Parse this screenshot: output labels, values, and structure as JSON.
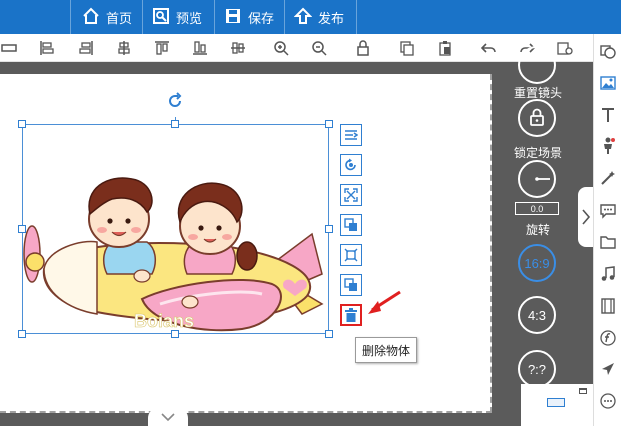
{
  "topbar": {
    "home_label": "首页",
    "preview_label": "预览",
    "save_label": "保存",
    "publish_label": "发布"
  },
  "toolbar": {
    "icons": [
      "align-left-icon",
      "align-left-edge-icon",
      "align-right-edge-icon",
      "align-center-h-icon",
      "align-top-icon",
      "align-bottom-icon",
      "align-center-v-icon",
      "zoom-in-icon",
      "zoom-out-icon",
      "lock-icon",
      "copy-icon",
      "paste-icon",
      "undo-icon",
      "redo-icon",
      "settings-icon"
    ]
  },
  "rightpanel": {
    "icons": [
      "layers-icon",
      "image-icon",
      "text-icon",
      "character-icon",
      "magic-icon",
      "speech-bubble-icon",
      "folder-icon",
      "music-icon",
      "film-icon",
      "formula-icon",
      "plane-icon",
      "more-icon"
    ]
  },
  "side": {
    "reset_camera_label": "重置镜头",
    "lock_scene_label": "锁定场景",
    "rotate_value": "0.0",
    "rotate_label": "旋转",
    "ratio_169": "16:9",
    "ratio_43": "4:3",
    "ratio_custom": "?:?"
  },
  "canvas": {
    "image_text": "Boians"
  },
  "tooltip": {
    "text": "删除物体"
  },
  "colors": {
    "topbar": "#1a73c8",
    "accent": "#2f7fd1",
    "workspace": "#5b5b5b",
    "delete_highlight": "#e02020"
  }
}
